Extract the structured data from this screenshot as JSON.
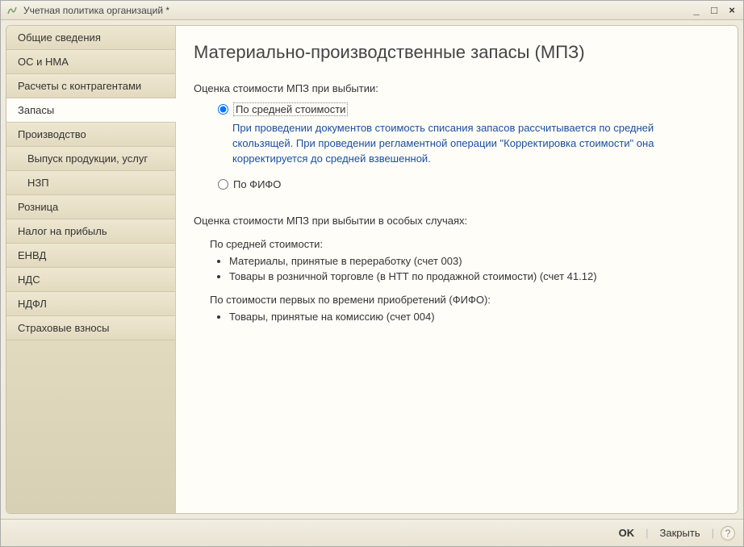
{
  "window": {
    "title": "Учетная политика организаций *"
  },
  "sidebar": {
    "items": [
      {
        "label": "Общие сведения",
        "active": false,
        "sub": false
      },
      {
        "label": "ОС и НМА",
        "active": false,
        "sub": false
      },
      {
        "label": "Расчеты с контрагентами",
        "active": false,
        "sub": false
      },
      {
        "label": "Запасы",
        "active": true,
        "sub": false
      },
      {
        "label": "Производство",
        "active": false,
        "sub": false
      },
      {
        "label": "Выпуск продукции, услуг",
        "active": false,
        "sub": true
      },
      {
        "label": "НЗП",
        "active": false,
        "sub": true
      },
      {
        "label": "Розница",
        "active": false,
        "sub": false
      },
      {
        "label": "Налог на прибыль",
        "active": false,
        "sub": false
      },
      {
        "label": "ЕНВД",
        "active": false,
        "sub": false
      },
      {
        "label": "НДС",
        "active": false,
        "sub": false
      },
      {
        "label": "НДФЛ",
        "active": false,
        "sub": false
      },
      {
        "label": "Страховые взносы",
        "active": false,
        "sub": false
      }
    ]
  },
  "main": {
    "heading": "Материально-производственные запасы (МПЗ)",
    "valuation_label": "Оценка стоимости МПЗ при выбытии:",
    "radios": {
      "avg": {
        "label": "По средней стоимости",
        "checked": true
      },
      "fifo": {
        "label": "По ФИФО",
        "checked": false
      }
    },
    "avg_hint": "При проведении документов стоимость списания запасов рассчитывается по средней скользящей. При проведении регламентной операции \"Корректировка стоимости\" она корректируется до средней взвешенной.",
    "special": {
      "heading": "Оценка стоимости МПЗ при выбытии в особых случаях:",
      "avg_heading": "По средней стоимости:",
      "avg_items": [
        "Материалы, принятые в переработку (счет 003)",
        "Товары в розничной торговле (в НТТ по продажной стоимости) (счет 41.12)"
      ],
      "fifo_heading": "По стоимости первых по времени приобретений (ФИФО):",
      "fifo_items": [
        "Товары, принятые на комиссию (счет 004)"
      ]
    }
  },
  "footer": {
    "ok": "OK",
    "close": "Закрыть"
  }
}
